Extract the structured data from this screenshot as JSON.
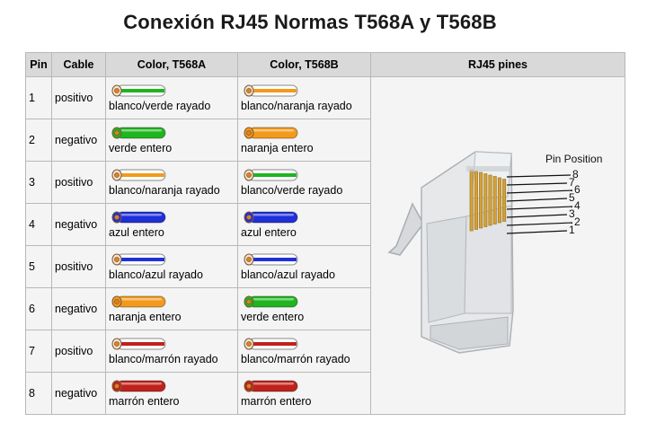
{
  "title": "Conexión RJ45 Normas T568A y T568B",
  "table": {
    "headers": {
      "pin": "Pin",
      "cable": "Cable",
      "color_a": "Color, T568A",
      "color_b": "Color, T568B",
      "pines": "RJ45 pines"
    },
    "rows": [
      {
        "pin": "1",
        "cable": "positivo",
        "a_label": "blanco/verde rayado",
        "b_label": "blanco/naranja rayado"
      },
      {
        "pin": "2",
        "cable": "negativo",
        "a_label": "verde entero",
        "b_label": "naranja entero"
      },
      {
        "pin": "3",
        "cable": "positivo",
        "a_label": "blanco/naranja rayado",
        "b_label": "blanco/verde rayado"
      },
      {
        "pin": "4",
        "cable": "negativo",
        "a_label": "azul entero",
        "b_label": "azul entero"
      },
      {
        "pin": "5",
        "cable": "positivo",
        "a_label": "blanco/azul rayado",
        "b_label": "blanco/azul rayado"
      },
      {
        "pin": "6",
        "cable": "negativo",
        "a_label": "naranja entero",
        "b_label": "verde entero"
      },
      {
        "pin": "7",
        "cable": "positivo",
        "a_label": "blanco/marrón rayado",
        "b_label": "blanco/marrón rayado"
      },
      {
        "pin": "8",
        "cable": "negativo",
        "a_label": "marrón entero",
        "b_label": "marrón entero"
      }
    ]
  },
  "connector": {
    "caption": "Pin Position",
    "pin_numbers": [
      "8",
      "7",
      "6",
      "5",
      "4",
      "3",
      "2",
      "1"
    ]
  },
  "colors": {
    "green": "#1fb51f",
    "orange": "#f39a1c",
    "blue": "#1f2fd9",
    "brown": "#c0221b",
    "white": "#ffffff",
    "header_bg": "#d9d9d9",
    "cell_bg": "#f4f4f4"
  }
}
